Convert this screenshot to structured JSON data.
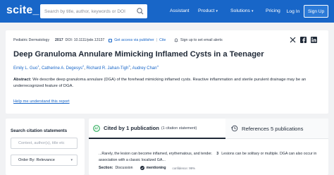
{
  "header": {
    "logo": "scite_",
    "search_placeholder": "Search by title, author, keywords or DOI",
    "nav": {
      "assistant": "Assistant",
      "product": "Product",
      "solutions": "Solutions",
      "pricing": "Pricing"
    },
    "login": "Log In",
    "signup": "Sign Up"
  },
  "paper": {
    "journal": "Pediatric Dermatology",
    "year": "2017",
    "doi": "DOI: 10.1111/pde.13137",
    "access_link": "Get access via publisher",
    "cite_link": "Cite",
    "alerts": "Sign up to set email alerts",
    "title": "Deep Granuloma Annulare Mimicking Inflamed Cysts in a Teenager",
    "authors": [
      {
        "name": "Emily L. Guo",
        "sup": "1"
      },
      {
        "name": "Catherine A. Degesys",
        "sup": "2"
      },
      {
        "name": "Richard R. Jahan-Tigh",
        "sup": "3"
      },
      {
        "name": "Audrey Chan",
        "sup": "4"
      }
    ],
    "abstract_label": "Abstract:",
    "abstract_text": "We describe deep granuloma annulare (DGA) of the forehead mimicking inflamed cysts. Reactive inflammation and sterile purulent drainage may be an underrecognized feature of DGA.",
    "help_link": "Help me understand this report"
  },
  "statements": {
    "title": "Search citation statements",
    "input_placeholder": "Context, author(s), title etc",
    "order_label": "Order By: Relevance"
  },
  "citations": {
    "tab_cited_bold": "Cited by 1 publication",
    "tab_cited_muted": "(1 citation statement)",
    "tab_refs": "References 5 publications",
    "quote_text": "...Rarely, the lesion can become inflamed, erythematous, and tender.",
    "quote_num": "3",
    "quote_rest": "Lesions can be solitary or multiple. DGA can also occur in association with a classic localized GA...",
    "section_label": "Section:",
    "section_value": "Discussion",
    "mentioning": "mentioning",
    "confidence": "confidence: 99%"
  },
  "colors": {
    "brand": "#1866c8",
    "background": "#f1f2f4"
  }
}
